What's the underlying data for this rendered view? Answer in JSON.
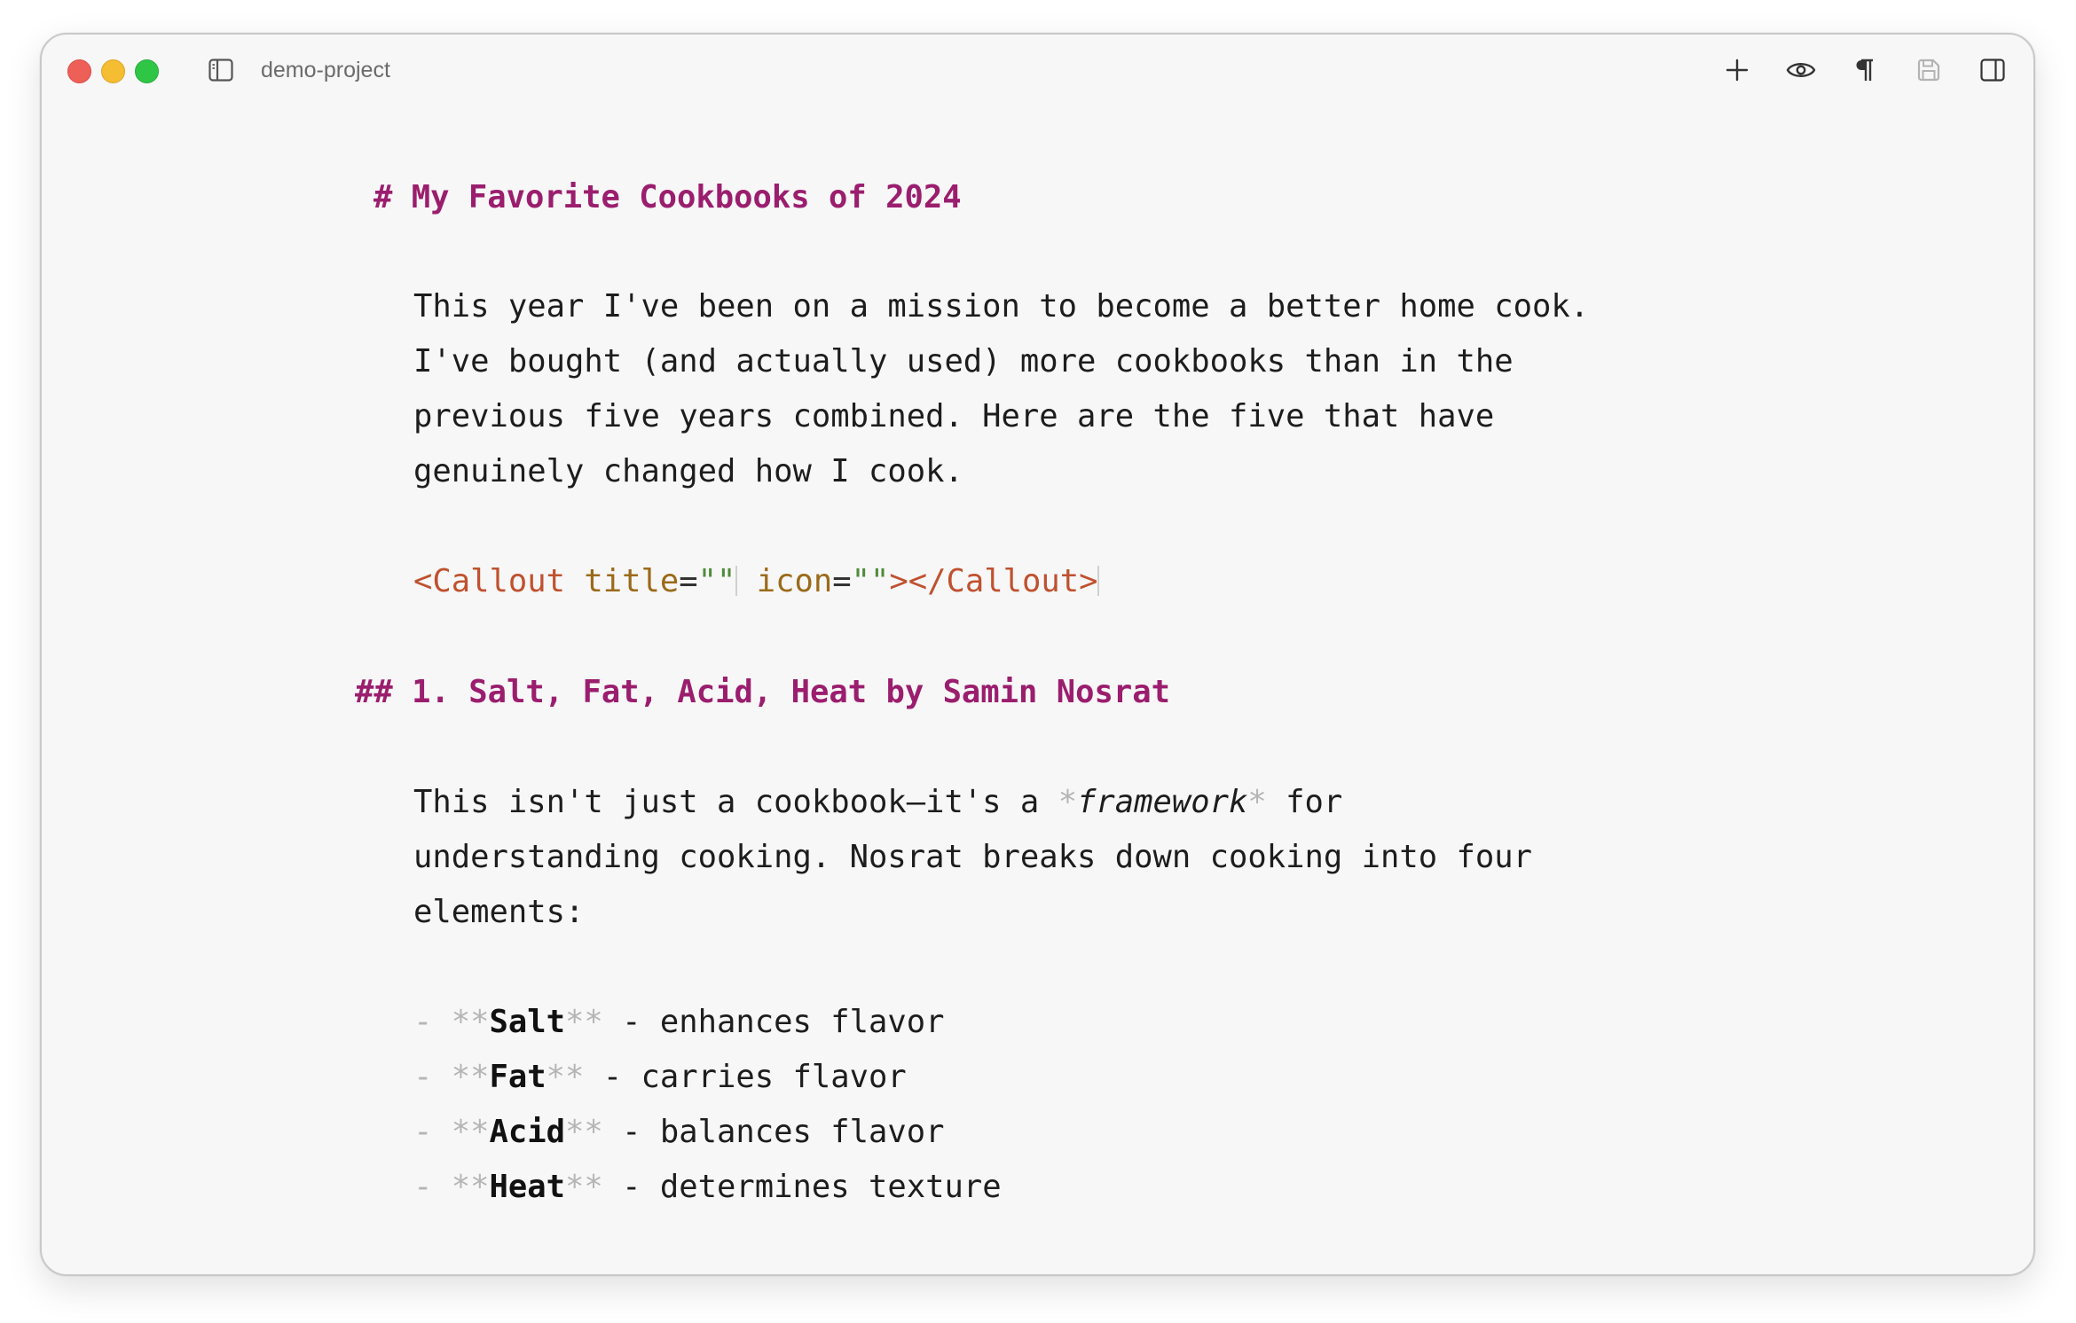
{
  "window": {
    "project_name": "demo-project"
  },
  "toolbar": {
    "icons": [
      "sidebar-left-icon",
      "plus-icon",
      "eye-icon",
      "pilcrow-icon",
      "save-icon",
      "sidebar-right-icon"
    ]
  },
  "document": {
    "h1_marker": "#",
    "h1_text": "My Favorite Cookbooks of 2024",
    "intro_lines": [
      "This year I've been on a mission to become a better home cook.",
      "I've bought (and actually used) more cookbooks than in the",
      "previous five years combined. Here are the five that have",
      "genuinely changed how I cook."
    ],
    "callout": {
      "open": "<Callout",
      "title_attr": "title",
      "eq": "=",
      "title_quotes": "\"\"",
      "icon_attr": "icon",
      "icon_quotes": "\"\"",
      "close": "></Callout>"
    },
    "h2_marker": "##",
    "h2_text": "1. Salt, Fat, Acid, Heat by Samin Nosrat",
    "para2": {
      "line1_pre": "This isn't just a cookbook—it's a ",
      "ital_marker": "*",
      "ital_text": "framework",
      "line1_post": " for",
      "line2": "understanding cooking. Nosrat breaks down cooking into four",
      "line3": "elements:"
    },
    "list": [
      {
        "dash": "-",
        "open": "**",
        "bold": "Salt",
        "close": "**",
        "rest": " - enhances flavor"
      },
      {
        "dash": "-",
        "open": "**",
        "bold": "Fat",
        "close": "**",
        "rest": " - carries flavor"
      },
      {
        "dash": "-",
        "open": "**",
        "bold": "Acid",
        "close": "**",
        "rest": " - balances flavor"
      },
      {
        "dash": "-",
        "open": "**",
        "bold": "Heat",
        "close": "**",
        "rest": " - determines texture"
      }
    ]
  }
}
